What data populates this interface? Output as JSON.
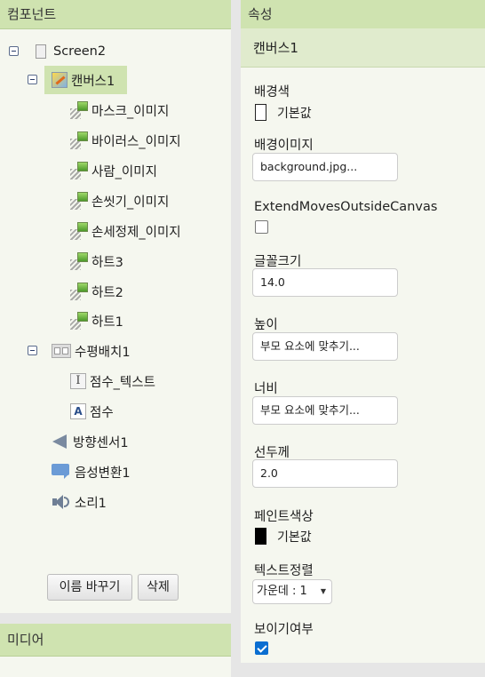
{
  "components_panel": {
    "title": "컴포넌트",
    "tree": {
      "screen": "Screen2",
      "canvas": "캔버스1",
      "sprites": [
        "마스크_이미지",
        "바이러스_이미지",
        "사람_이미지",
        "손씻기_이미지",
        "손세정제_이미지",
        "하트3",
        "하트2",
        "하트1"
      ],
      "hbox": "수평배치1",
      "hbox_children": [
        "점수_텍스트",
        "점수"
      ],
      "orientation_sensor": "방향센서1",
      "tts": "음성변환1",
      "sound": "소리1"
    },
    "rename_button": "이름 바꾸기",
    "delete_button": "삭제"
  },
  "media_panel": {
    "title": "미디어"
  },
  "properties_panel": {
    "title": "속성",
    "component_name": "캔버스1",
    "background_color": {
      "label": "배경색",
      "value": "기본값",
      "color": "#ffffff"
    },
    "background_image": {
      "label": "배경이미지",
      "value": "background.jpg..."
    },
    "extend_moves": {
      "label": "ExtendMovesOutsideCanvas",
      "checked": false
    },
    "font_size": {
      "label": "글꼴크기",
      "value": "14.0"
    },
    "height": {
      "label": "높이",
      "value": "부모 요소에 맞추기..."
    },
    "width": {
      "label": "너비",
      "value": "부모 요소에 맞추기..."
    },
    "line_width": {
      "label": "선두께",
      "value": "2.0"
    },
    "paint_color": {
      "label": "페인트색상",
      "value": "기본값",
      "color": "#000000"
    },
    "text_alignment": {
      "label": "텍스트정렬",
      "value": "가운데 : 1"
    },
    "visible": {
      "label": "보이기여부",
      "checked": true
    }
  }
}
